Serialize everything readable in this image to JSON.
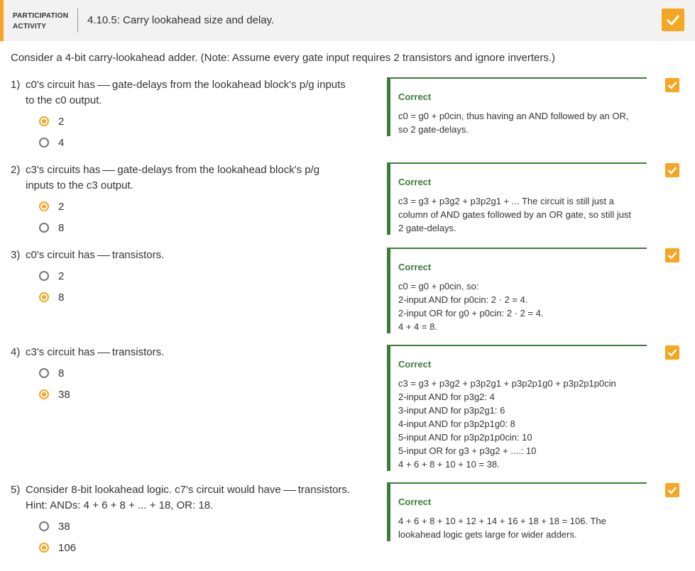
{
  "header": {
    "badge_line1": "PARTICIPATION",
    "badge_line2": "ACTIVITY",
    "title": "4.10.5: Carry lookahead size and delay."
  },
  "intro": "Consider a 4-bit carry-lookahead adder. (Note: Assume every gate input requires 2 transistors and ignore inverters.)",
  "questions": [
    {
      "num": "1)",
      "pre": "c0's circuit has",
      "post": "gate-delays from the lookahead block's p/g inputs",
      "line2": "to the c0 output.",
      "options": [
        {
          "label": "2",
          "selected": true
        },
        {
          "label": "4",
          "selected": false
        }
      ],
      "feedback": {
        "title": "Correct",
        "lines": [
          "c0 = g0 + p0cin, thus having an AND followed by an OR,",
          "so 2 gate-delays."
        ]
      }
    },
    {
      "num": "2)",
      "pre": "c3's circuits has",
      "post": "gate-delays from the lookahead block's p/g",
      "line2": "inputs to the c3 output.",
      "options": [
        {
          "label": "2",
          "selected": true
        },
        {
          "label": "8",
          "selected": false
        }
      ],
      "feedback": {
        "title": "Correct",
        "lines": [
          "c3 = g3 + p3g2 + p3p2g1 + ... The circuit is still just a",
          "column of AND gates followed by an OR gate, so still just",
          "2 gate-delays."
        ]
      }
    },
    {
      "num": "3)",
      "pre": "c0's circuit has",
      "post": "transistors.",
      "line2": "",
      "options": [
        {
          "label": "2",
          "selected": false
        },
        {
          "label": "8",
          "selected": true
        }
      ],
      "feedback": {
        "title": "Correct",
        "lines": [
          "c0 = g0 + p0cin, so:",
          "2-input AND for p0cin: 2 · 2 = 4.",
          "2-input OR for g0 + p0cin: 2 · 2 = 4.",
          "4 + 4 = 8."
        ]
      }
    },
    {
      "num": "4)",
      "pre": "c3's circuit has",
      "post": "transistors.",
      "line2": "",
      "options": [
        {
          "label": "8",
          "selected": false
        },
        {
          "label": "38",
          "selected": true
        }
      ],
      "feedback": {
        "title": "Correct",
        "lines": [
          "c3 = g3 + p3g2 + p3p2g1 + p3p2p1g0 + p3p2p1p0cin",
          "2-input AND for p3g2: 4",
          "3-input AND for p3p2g1: 6",
          "4-input AND for p3p2p1g0: 8",
          "5-input AND for p3p2p1p0cin: 10",
          "5-input OR for g3 + p3g2 + ....: 10",
          "4 + 6 + 8 + 10 + 10 = 38."
        ]
      }
    },
    {
      "num": "5)",
      "pre": "Consider 8-bit lookahead logic. c7's circuit would have",
      "post": "transistors.",
      "line2": "Hint: ANDs: 4 + 6 + 8 + ... + 18, OR: 18.",
      "options": [
        {
          "label": "38",
          "selected": false
        },
        {
          "label": "106",
          "selected": true
        }
      ],
      "feedback": {
        "title": "Correct",
        "lines": [
          "4 + 6 + 8 + 10 + 12 + 14 + 16 + 18 + 18 = 106. The",
          "lookahead logic gets large for wider adders."
        ]
      }
    }
  ],
  "colors": {
    "accent": "#f5a623",
    "correct": "#3a7d3a"
  }
}
